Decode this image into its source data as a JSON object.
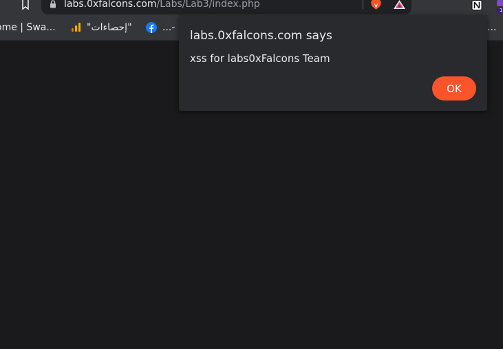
{
  "browser": {
    "url_host": "labs.0xfalcons.com",
    "url_path": "/Labs/Lab3/index.php"
  },
  "bookmarks": [
    {
      "label": "ome | Swa...",
      "icon": "none"
    },
    {
      "label": "\"إحصاءات\"",
      "icon": "analytics-icon"
    },
    {
      "label": "...-",
      "icon": "facebook-icon"
    },
    {
      "label": "...",
      "icon": "none"
    }
  ],
  "extensions": [
    {
      "icon": "brave-shields-icon"
    },
    {
      "icon": "brave-rewards-icon"
    },
    {
      "icon": "notion-icon"
    },
    {
      "icon": "extension-icon",
      "badge": "1"
    }
  ],
  "dialog": {
    "title": "labs.0xfalcons.com says",
    "message": "xss for labs0xFalcons Team",
    "ok_label": "OK"
  },
  "colors": {
    "page_bg": "#1a1a1c",
    "toolbar_bg": "#35363a",
    "dialog_bg": "#292a2d",
    "accent": "#fb542b"
  }
}
